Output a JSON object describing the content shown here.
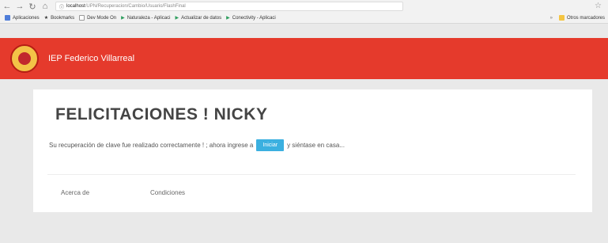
{
  "browser": {
    "url_host": "localhost",
    "url_path": "/UPN/Recuperacion/Cambio/Usuario/FlashFinal",
    "bookmarks": [
      {
        "label": "Aplicaciones",
        "color": "#4f7dd9"
      },
      {
        "label": "Bookmarks",
        "color": "#333333"
      },
      {
        "label": "Dev Mode On",
        "color": "#bdbdbd"
      },
      {
        "label": "Naturaleza - Aplicaci",
        "color": "#2e9e5e"
      },
      {
        "label": "Actualizar de datos",
        "color": "#2e9e5e"
      },
      {
        "label": "Conectivity - Aplicaci",
        "color": "#2e9e5e"
      }
    ],
    "other_bookmarks": "Otros marcadores"
  },
  "header": {
    "brand": "IEP Federico Villarreal"
  },
  "card": {
    "title": "FELICITACIONES ! NICKY",
    "message_before": "Su recuperación de clave fue realizado correctamente ! ; ahora ingrese a",
    "button_label": "Iniciar",
    "message_after": "y siéntase en casa...",
    "footer_links": [
      "Acerca de",
      "Condiciones"
    ]
  }
}
